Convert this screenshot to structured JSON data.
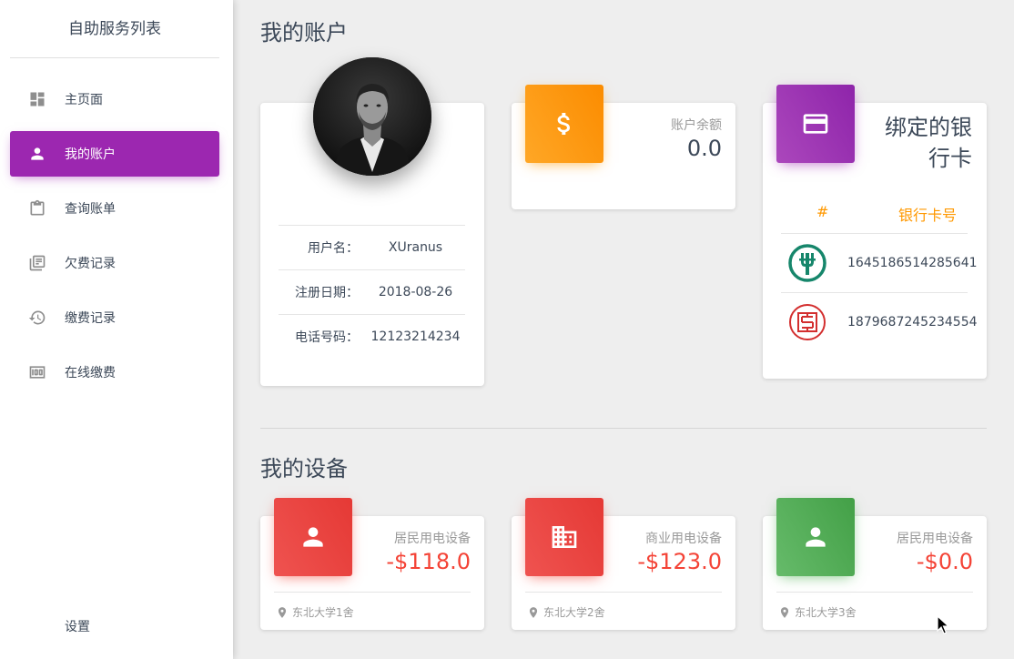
{
  "sidebar": {
    "title": "自助服务列表",
    "items": [
      {
        "label": "主页面",
        "icon": "dashboard-icon",
        "active": false
      },
      {
        "label": "我的账户",
        "icon": "person-icon",
        "active": true
      },
      {
        "label": "查询账单",
        "icon": "clipboard-icon",
        "active": false
      },
      {
        "label": "欠费记录",
        "icon": "library-books-icon",
        "active": false
      },
      {
        "label": "缴费记录",
        "icon": "history-icon",
        "active": false
      },
      {
        "label": "在线缴费",
        "icon": "money-icon",
        "active": false
      }
    ],
    "settings_label": "设置"
  },
  "account": {
    "section_title": "我的账户",
    "profile": {
      "rows": [
        {
          "label": "用户名：",
          "value": "XUranus"
        },
        {
          "label": "注册日期：",
          "value": "2018-08-26"
        },
        {
          "label": "电话号码：",
          "value": "12123214234"
        }
      ]
    },
    "balance": {
      "label": "账户余额",
      "value": "0.0",
      "icon": "dollar-icon"
    },
    "bank": {
      "title": "绑定的银行卡",
      "icon": "credit-card-icon",
      "columns": [
        "#",
        "银行卡号"
      ],
      "cards": [
        {
          "logo": "abc-bank-logo",
          "number": "1645186514285641"
        },
        {
          "logo": "icbc-bank-logo",
          "number": "1879687245234554"
        }
      ]
    }
  },
  "devices": {
    "section_title": "我的设备",
    "items": [
      {
        "type": "居民用电设备",
        "amount": "-$118.0",
        "location": "东北大学1舍",
        "icon": "person-icon"
      },
      {
        "type": "商业用电设备",
        "amount": "-$123.0",
        "location": "东北大学2舍",
        "icon": "business-icon"
      },
      {
        "type": "居民用电设备",
        "amount": "-$0.0",
        "location": "东北大学3舍",
        "icon": "person-icon"
      }
    ]
  },
  "colors": {
    "primary": "#9c27b0",
    "warning": "#ff9800",
    "danger": "#f44336",
    "success": "#4caf50"
  }
}
